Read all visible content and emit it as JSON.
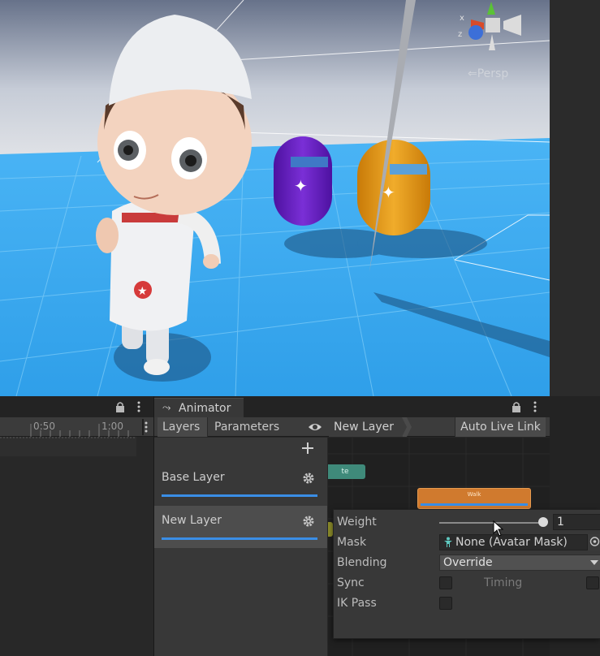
{
  "scene": {
    "view_mode": "Persp",
    "gizmo_axes": {
      "x": "x",
      "z": "z"
    },
    "colors": {
      "sky_top": "#6f7a8f",
      "sky_horizon": "#d9dde4",
      "floor": "#3aa9f2",
      "purple_capsule": "#6a1fc0",
      "orange_capsule": "#e59a19"
    }
  },
  "animator": {
    "tab_label": "Animator",
    "toolbar": {
      "layers_label": "Layers",
      "parameters_label": "Parameters",
      "breadcrumb": "New Layer",
      "auto_live_link_label": "Auto Live Link"
    },
    "layers": [
      {
        "name": "Base Layer"
      },
      {
        "name": "New Layer"
      }
    ],
    "graph": {
      "node_orange_label": "Walk",
      "node_teal_label": "te"
    }
  },
  "timeline": {
    "ticks": [
      "0:50",
      "1:00"
    ]
  },
  "layer_settings": {
    "weight_label": "Weight",
    "weight_value": "1",
    "weight_fraction": 1.0,
    "mask_label": "Mask",
    "mask_value": "None (Avatar Mask)",
    "blending_label": "Blending",
    "blending_value": "Override",
    "sync_label": "Sync",
    "timing_label": "Timing",
    "ik_pass_label": "IK Pass"
  },
  "colors": {
    "accent_blue": "#3a8ee6",
    "panel": "#383838",
    "selected_layer": "#4d4d4d"
  }
}
